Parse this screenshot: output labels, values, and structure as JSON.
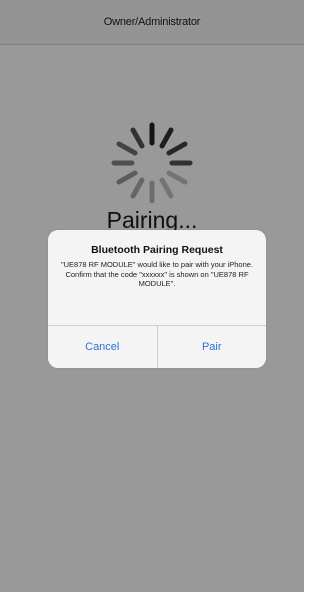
{
  "nav": {
    "title": "Owner/Administrator"
  },
  "main": {
    "status_text": "Pairing...",
    "spinner_icon": "activity-indicator-icon"
  },
  "alert": {
    "title": "Bluetooth Pairing Request",
    "message": "\"UE878 RF MODULE\" would like to pair with your iPhone. Confirm that the code \"xxxxxx\" is shown on \"UE878 RF MODULE\".",
    "cancel_label": "Cancel",
    "pair_label": "Pair"
  },
  "colors": {
    "accent": "#2f6fdc",
    "overlay": "rgba(0,0,0,0.40)"
  }
}
